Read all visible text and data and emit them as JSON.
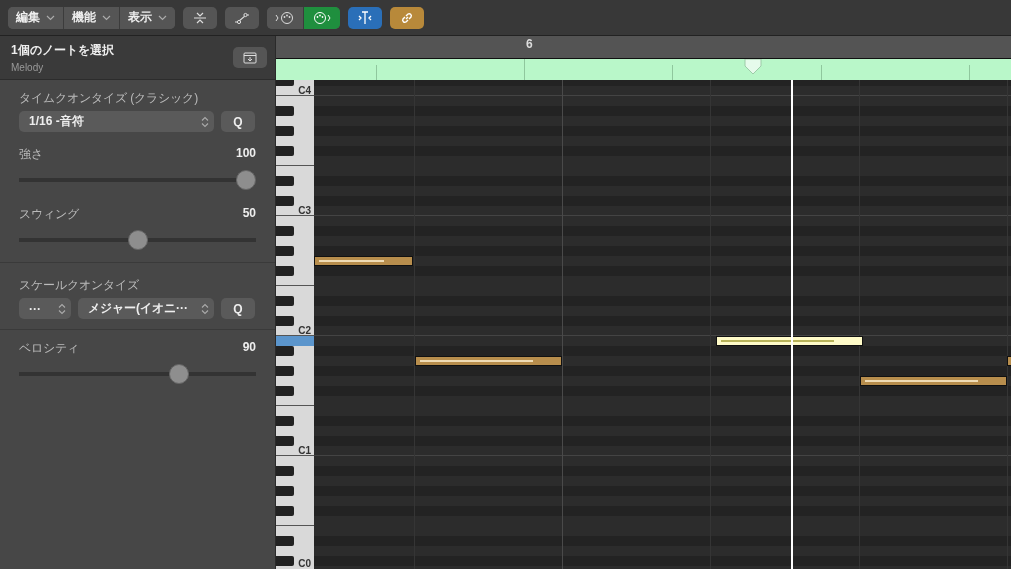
{
  "toolbar": {
    "menus": [
      {
        "label": "編集"
      },
      {
        "label": "機能"
      },
      {
        "label": "表示"
      }
    ],
    "tools": [
      {
        "kind": "collapse",
        "on": false
      },
      {
        "kind": "automation",
        "on": false
      }
    ],
    "midi": [
      {
        "kind": "midi-in",
        "on": false
      },
      {
        "kind": "midi-out",
        "on": true,
        "color": "#1f8f3e"
      }
    ],
    "toggles": [
      {
        "kind": "catch",
        "on": true,
        "color": "#2a6fb8"
      },
      {
        "kind": "link",
        "on": true,
        "color": "#b8893a"
      }
    ]
  },
  "inspector": {
    "title": "1個のノートを選択",
    "subtitle": "Melody",
    "time_quantize": {
      "title": "タイムクオンタイズ (クラシック)",
      "value": "1/16 -音符",
      "button": "Q",
      "sliders": [
        {
          "label": "強さ",
          "reading": "100",
          "level": 1
        },
        {
          "label": "スウィング",
          "reading": "50",
          "level": 0.5
        }
      ]
    },
    "scale_quantize": {
      "title": "スケールクオンタイズ",
      "root": "···",
      "scale": "メジャー(イオニ···",
      "button": "Q"
    },
    "velocity": {
      "label": "ベロシティ",
      "reading": "90",
      "level": 0.69
    }
  },
  "editor": {
    "ruler": {
      "bar": "6"
    },
    "octave_labels": [
      "C4",
      "C3",
      "C2",
      "C1",
      "C0"
    ],
    "notes": [
      {
        "selected": false
      },
      {
        "selected": false
      },
      {
        "selected": true
      },
      {
        "selected": false
      },
      {
        "selected": false
      }
    ]
  }
}
